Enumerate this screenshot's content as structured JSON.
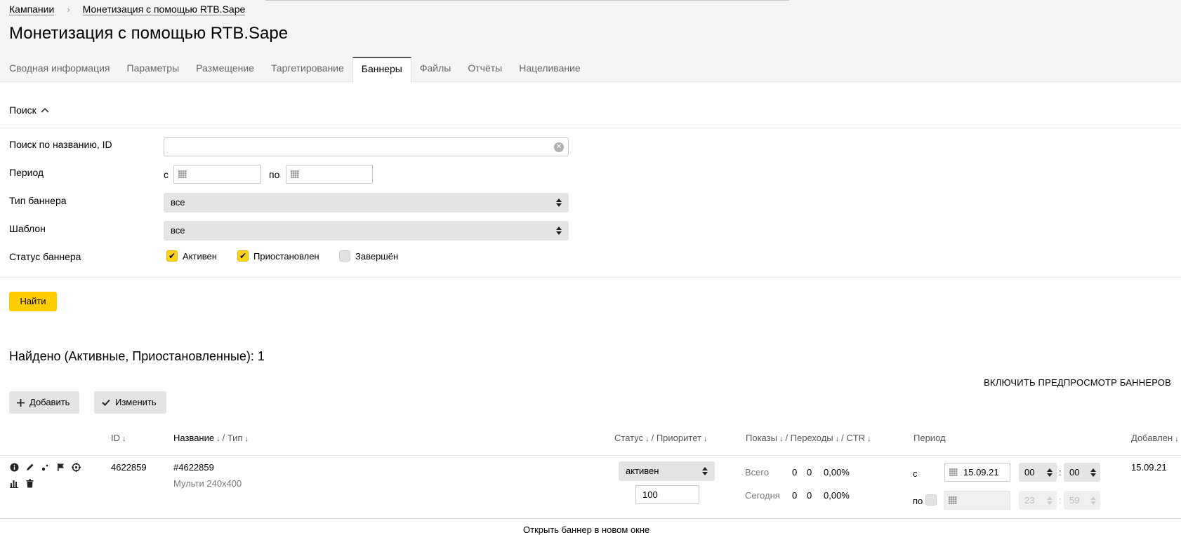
{
  "breadcrumbs": {
    "root": "Кампании",
    "current": "Монетизация с помощью RTB.Sape",
    "separator": "›"
  },
  "page_title": "Монетизация с помощью RTB.Sape",
  "tabs": [
    {
      "label": "Сводная информация"
    },
    {
      "label": "Параметры"
    },
    {
      "label": "Размещение"
    },
    {
      "label": "Таргетирование"
    },
    {
      "label": "Баннеры",
      "active": true
    },
    {
      "label": "Файлы"
    },
    {
      "label": "Отчёты"
    },
    {
      "label": "Нацеливание"
    }
  ],
  "search": {
    "toggle_label": "Поиск",
    "name_label": "Поиск по названию, ID",
    "name_value": "",
    "period_label": "Период",
    "from_label": "с",
    "to_label": "по",
    "banner_type_label": "Тип баннера",
    "banner_type_value": "все",
    "template_label": "Шаблон",
    "template_value": "все",
    "status_label": "Статус баннера",
    "status_active": "Активен",
    "status_paused": "Приостановлен",
    "status_finished": "Завершён",
    "find_button": "Найти"
  },
  "results": {
    "found_text": "Найдено (Активные, Приостановленные): 1",
    "preview_link": "ВКЛЮЧИТЬ ПРЕДПРОСМОТР БАННЕРОВ",
    "add_button": "Добавить",
    "edit_button": "Изменить"
  },
  "table": {
    "headers": {
      "id": "ID",
      "name": "Название",
      "type": "/ Тип",
      "status": "Статус",
      "priority": "/ Приоритет",
      "impressions": "Показы",
      "clicks": "/ Переходы",
      "ctr": "/ CTR",
      "period": "Период",
      "added": "Добавлен",
      "sort_glyph": "↓"
    },
    "row": {
      "id": "4622859",
      "name": "#4622859",
      "type": "Мульти 240x400",
      "status": "активен",
      "priority": "100",
      "total_label": "Всего",
      "total_impressions": "0",
      "total_clicks": "0",
      "total_ctr": "0,00%",
      "today_label": "Сегодня",
      "today_impressions": "0",
      "today_clicks": "0",
      "today_ctr": "0,00%",
      "period_from_label": "с",
      "period_from_date": "15.09.21",
      "period_from_hour": "00",
      "period_from_minute": "00",
      "period_to_label": "по",
      "period_to_hour": "23",
      "period_to_minute": "59",
      "time_sep": ":",
      "added": "15.09.21"
    }
  },
  "bottom_hint": "Открыть баннер в новом окне"
}
